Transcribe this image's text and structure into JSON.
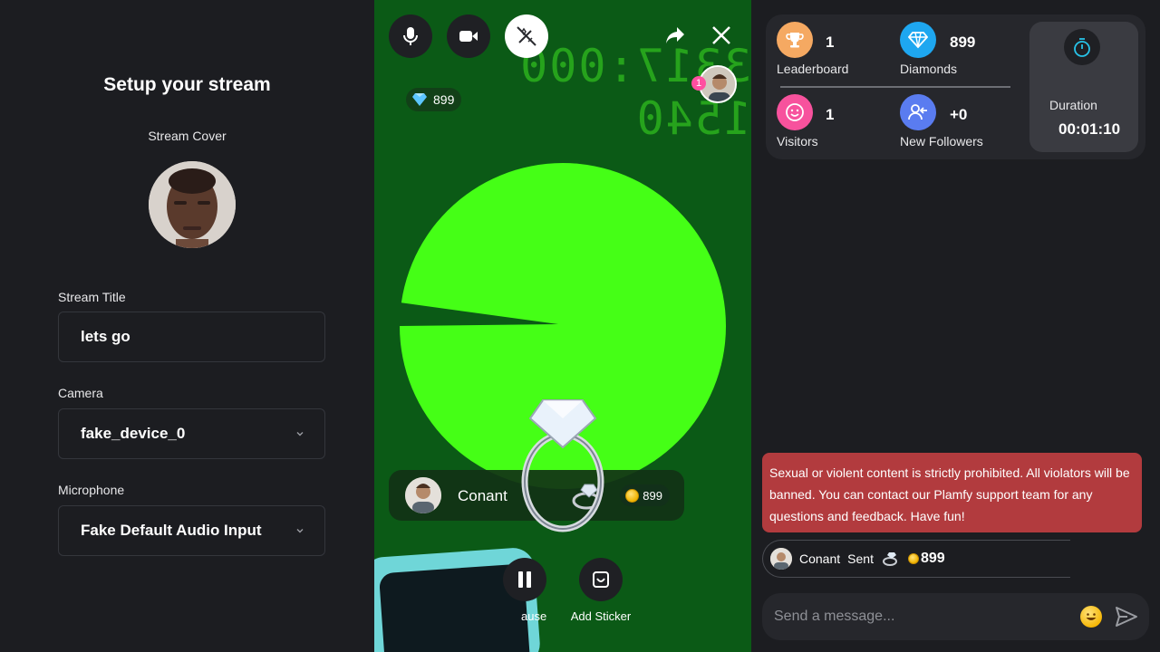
{
  "setup": {
    "title": "Setup your stream",
    "cover_label": "Stream Cover",
    "title_label": "Stream Title",
    "title_value": "lets go",
    "camera_label": "Camera",
    "camera_value": "fake_device_0",
    "mic_label": "Microphone",
    "mic_value": "Fake Default Audio Input"
  },
  "video": {
    "mirror_text": "3317:000 1540",
    "diamonds": "899",
    "viewer_count": "1",
    "gift_sender": "Conant",
    "gift_amount": "899",
    "pause_label": "ause",
    "sticker_label": "Add Sticker"
  },
  "stats": {
    "leaderboard_value": "1",
    "leaderboard_label": "Leaderboard",
    "diamonds_value": "899",
    "diamonds_label": "Diamonds",
    "visitors_value": "1",
    "visitors_label": "Visitors",
    "followers_value": "+0",
    "followers_label": "New Followers",
    "duration_label": "Duration",
    "duration_value": "00:01:10"
  },
  "chat": {
    "warning": "Sexual or violent content is strictly prohibited. All violators will be banned. You can contact our Plamfy support team for any questions and feedback. Have fun!",
    "gift_user": "Conant",
    "gift_action": "Sent",
    "gift_amount": "899",
    "placeholder": "Send a message..."
  },
  "colors": {
    "leaderboard": "#f5a962",
    "diamonds": "#1ea7f0",
    "visitors": "#f7529d",
    "followers": "#5a7cf0",
    "warning": "#b23b3e"
  }
}
